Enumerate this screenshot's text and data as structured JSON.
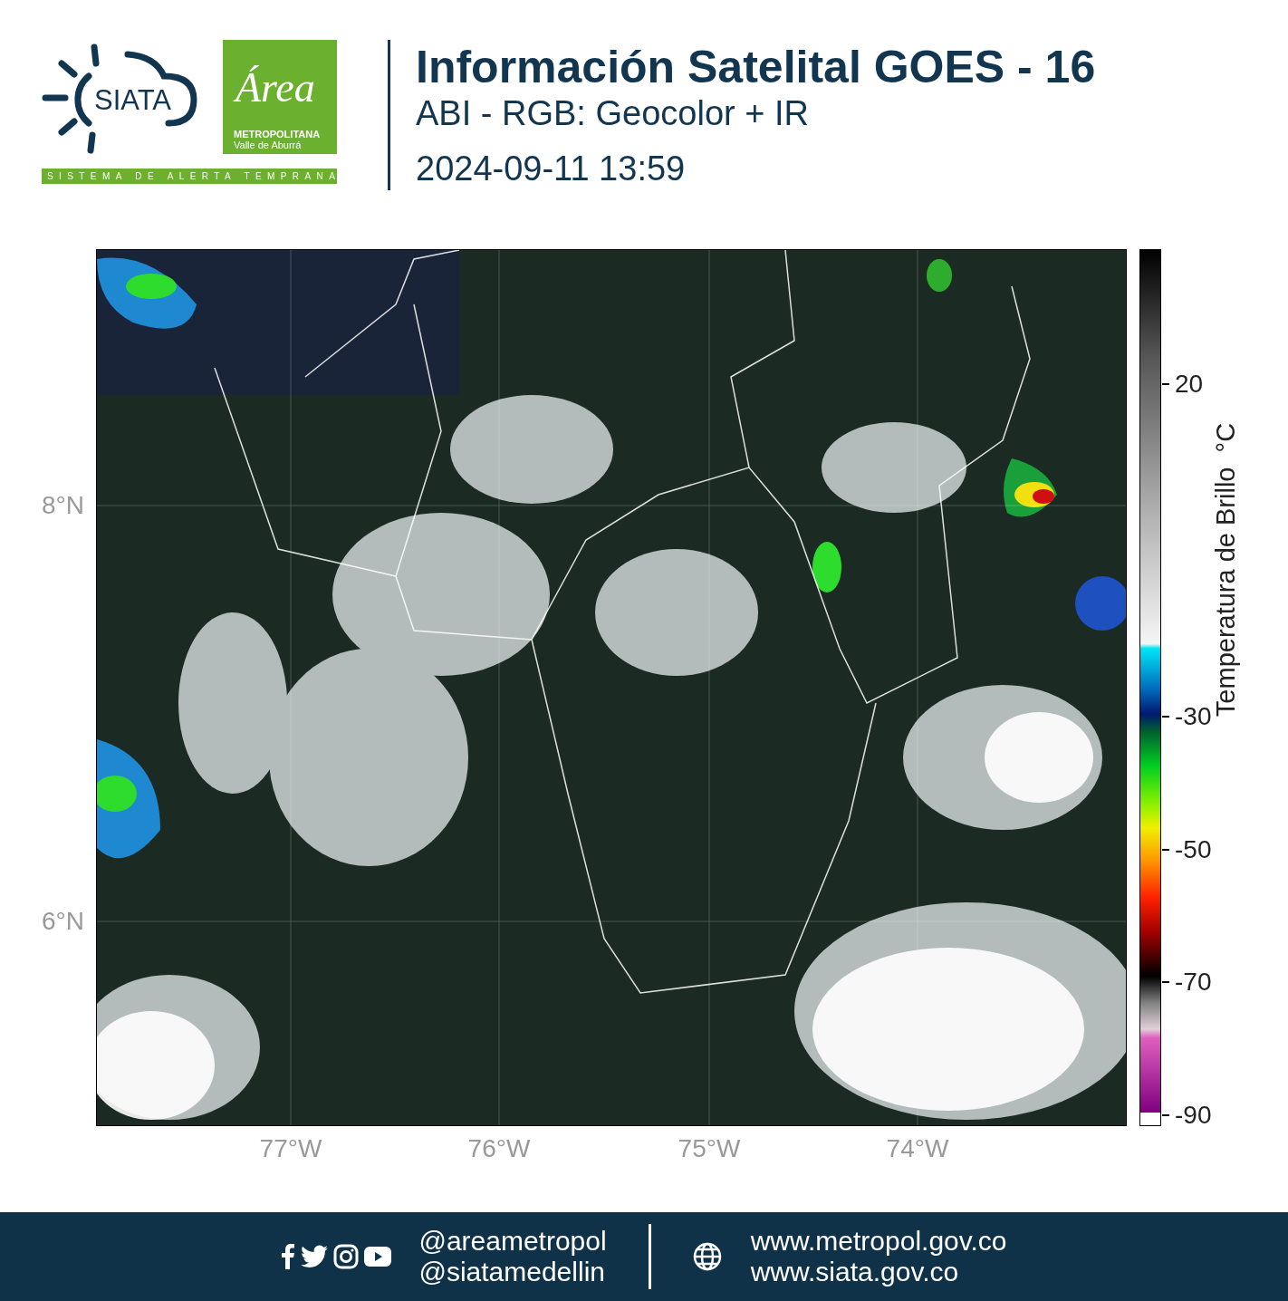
{
  "header": {
    "logo_siata": {
      "name": "SIATA",
      "tagline": "SISTEMA DE ALERTA TEMPRANA"
    },
    "logo_area": {
      "script": "Área",
      "line_1": "METROPOLITANA",
      "line_2": "Valle de Aburrá"
    },
    "title": "Información Satelital GOES - 16",
    "subtitle": "ABI - RGB: Geocolor + IR",
    "timestamp": "2024-09-11 13:59"
  },
  "map": {
    "y_labels": [
      "8°N",
      "6°N"
    ],
    "x_labels": [
      "77°W",
      "76°W",
      "75°W",
      "74°W"
    ]
  },
  "colorbar": {
    "title": "Temperatura de Brillo  °C",
    "ticks": [
      "20",
      "-30",
      "-50",
      "-70",
      "-90"
    ]
  },
  "footer": {
    "handles": [
      "@areametropol",
      "@siatamedellin"
    ],
    "websites": [
      "www.metropol.gov.co",
      "www.siata.gov.co"
    ]
  }
}
